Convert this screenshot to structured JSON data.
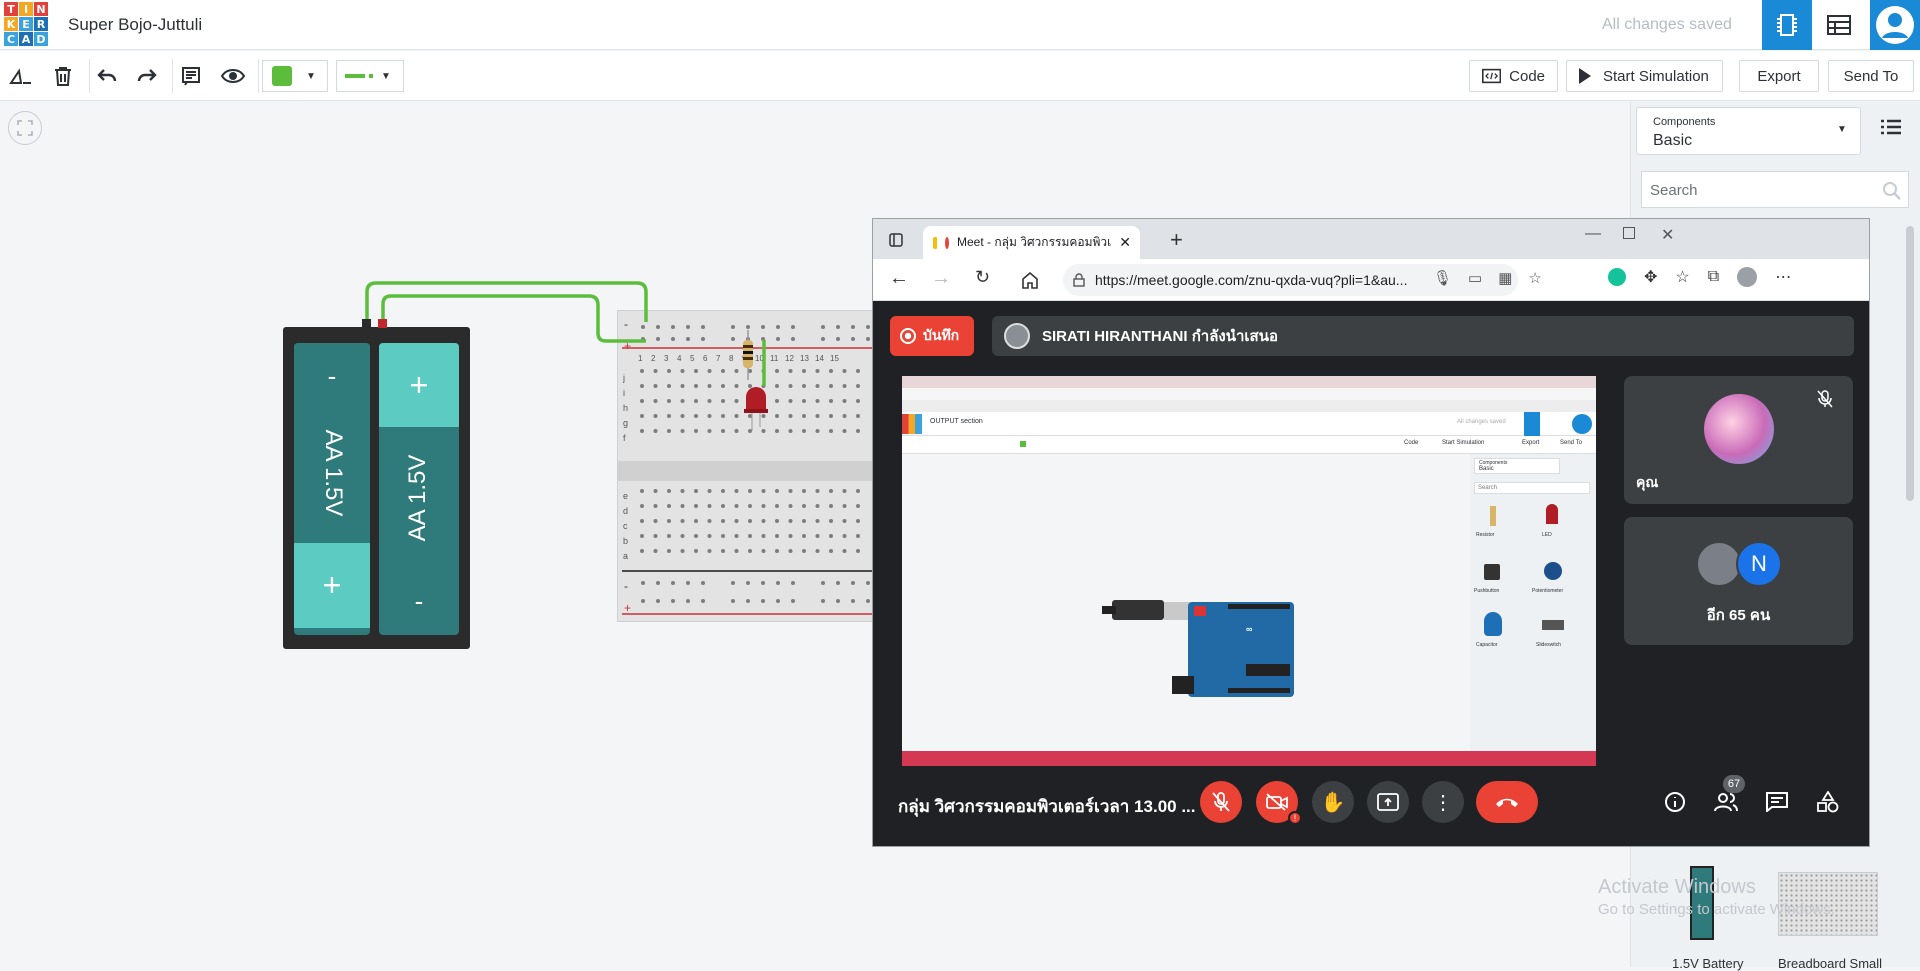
{
  "header": {
    "title": "Super Bojo-Juttuli",
    "status": "All changes saved",
    "logo_letters": [
      "T",
      "I",
      "N",
      "K",
      "E",
      "R",
      "C",
      "A",
      "D"
    ]
  },
  "toolbar": {
    "code_label": "Code",
    "start_simulation_label": "Start Simulation",
    "export_label": "Export",
    "send_to_label": "Send To",
    "fill_color": "#5cbd3c",
    "wire_color": "#5cbd3c"
  },
  "components_panel": {
    "dropdown_label": "Components",
    "dropdown_value": "Basic",
    "search_placeholder": "Search",
    "items": [
      "1.5V Battery",
      "Breadboard Small"
    ]
  },
  "circuit": {
    "battery_labels": [
      "AA 1.5V",
      "AA 1.5V"
    ],
    "battery_signs": [
      "-",
      "+",
      "+",
      "-"
    ],
    "breadboard_rows_top": [
      "j",
      "i",
      "h",
      "g",
      "f"
    ],
    "breadboard_rows_bottom": [
      "e",
      "d",
      "c",
      "b",
      "a"
    ],
    "breadboard_columns": [
      "1",
      "2",
      "3",
      "4",
      "5",
      "6",
      "7",
      "8",
      "9",
      "10",
      "11",
      "12",
      "13",
      "14",
      "15"
    ],
    "rail_minus": "-",
    "rail_plus": "+"
  },
  "meet": {
    "tab_title": "Meet - กลุ่ม วิศวกรรมคอมพิวเ",
    "url": "https://meet.google.com/znu-qxda-vuq?pli=1&au...",
    "record_label": "บันทึก",
    "presenter_text": "SIRATI HIRANTHANI กำลังนำเสนอ",
    "meeting_name": "กลุ่ม วิศวกรรมคอมพิวเตอร์เวลา 13.00 ...",
    "self_label": "คุณ",
    "others_label": "อีก 65 คน",
    "avatar_letter": "N",
    "people_count": "67",
    "shared_screen": {
      "project_title": "OUTPUT section",
      "status": "All changes saved",
      "code_label": "Code",
      "start_label": "Start Simulation",
      "export_label": "Export",
      "send_label": "Send To",
      "components_label": "Components",
      "components_value": "Basic",
      "search_placeholder": "Search",
      "items": [
        "Resistor",
        "LED",
        "Pushbutton",
        "Potentiometer",
        "Capacitor",
        "Slideswitch"
      ]
    }
  },
  "watermark": {
    "line1": "Activate Windows",
    "line2": "Go to Settings to activate Windows."
  },
  "colors": {
    "accent": "#1a89d6",
    "battery_teal": "#2f7a7a",
    "battery_cap": "#5ccbc2",
    "wire": "#5cbd3c",
    "meet_red": "#ea4335"
  }
}
